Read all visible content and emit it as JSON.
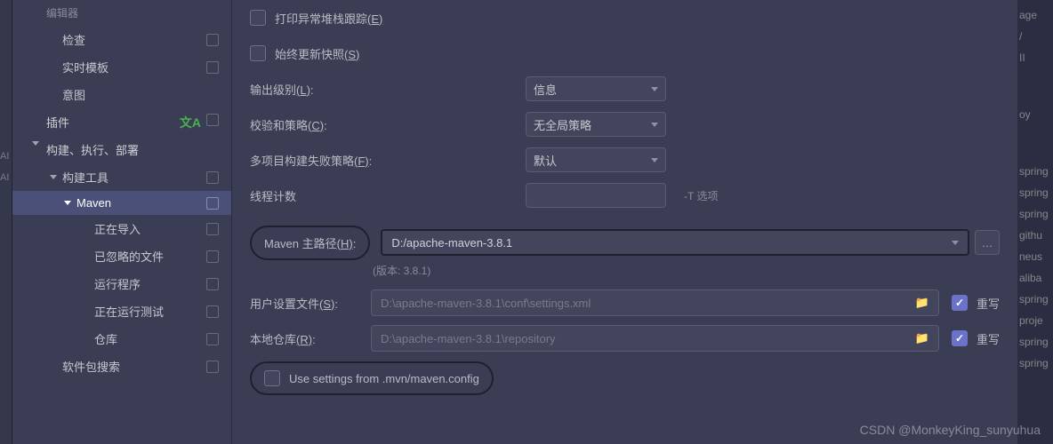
{
  "sidebar": {
    "items": [
      {
        "label": "检查"
      },
      {
        "label": "实时模板"
      },
      {
        "label": "意图"
      }
    ],
    "plugins_label": "插件",
    "build_label": "构建、执行、部署",
    "build_tools_label": "构建工具",
    "maven_label": "Maven",
    "maven_children": [
      {
        "label": "正在导入"
      },
      {
        "label": "已忽略的文件"
      },
      {
        "label": "运行程序"
      },
      {
        "label": "正在运行测试"
      },
      {
        "label": "仓库"
      }
    ],
    "package_search_label": "软件包搜索"
  },
  "form": {
    "print_stack": "打印异常堆栈跟踪",
    "print_stack_hotkey": "(E)",
    "always_update": "始终更新快照",
    "always_update_hotkey": "(S)",
    "output_level_label": "输出级别",
    "output_level_hotkey": "(L)",
    "output_level_value": "信息",
    "checksum_label": "校验和策略",
    "checksum_hotkey": "(C)",
    "checksum_value": "无全局策略",
    "multi_fail_label": "多项目构建失败策略",
    "multi_fail_hotkey": "(F)",
    "multi_fail_value": "默认",
    "thread_count_label": "线程计数",
    "thread_hint": "-T 选项",
    "maven_home_label": "Maven 主路径",
    "maven_home_hotkey": "(H)",
    "maven_home_value": "D:/apache-maven-3.8.1",
    "version_label": "(版本: 3.8.1)",
    "user_settings_label": "用户设置文件",
    "user_settings_hotkey": "(S)",
    "user_settings_value": "D:\\apache-maven-3.8.1\\conf\\settings.xml",
    "local_repo_label": "本地仓库",
    "local_repo_hotkey": "(R)",
    "local_repo_value": "D:\\apache-maven-3.8.1\\repository",
    "override_label": "重写",
    "use_mvn_config": "Use settings from .mvn/maven.config",
    "browse_btn": "…"
  },
  "right_edge": {
    "items": [
      "age",
      "/",
      "II",
      "oy",
      "spring",
      "spring",
      "spring",
      "githu",
      "neus",
      "aliba",
      "spring",
      "proje",
      "spring",
      "spring"
    ]
  },
  "watermark": "CSDN @MonkeyKing_sunyuhua"
}
